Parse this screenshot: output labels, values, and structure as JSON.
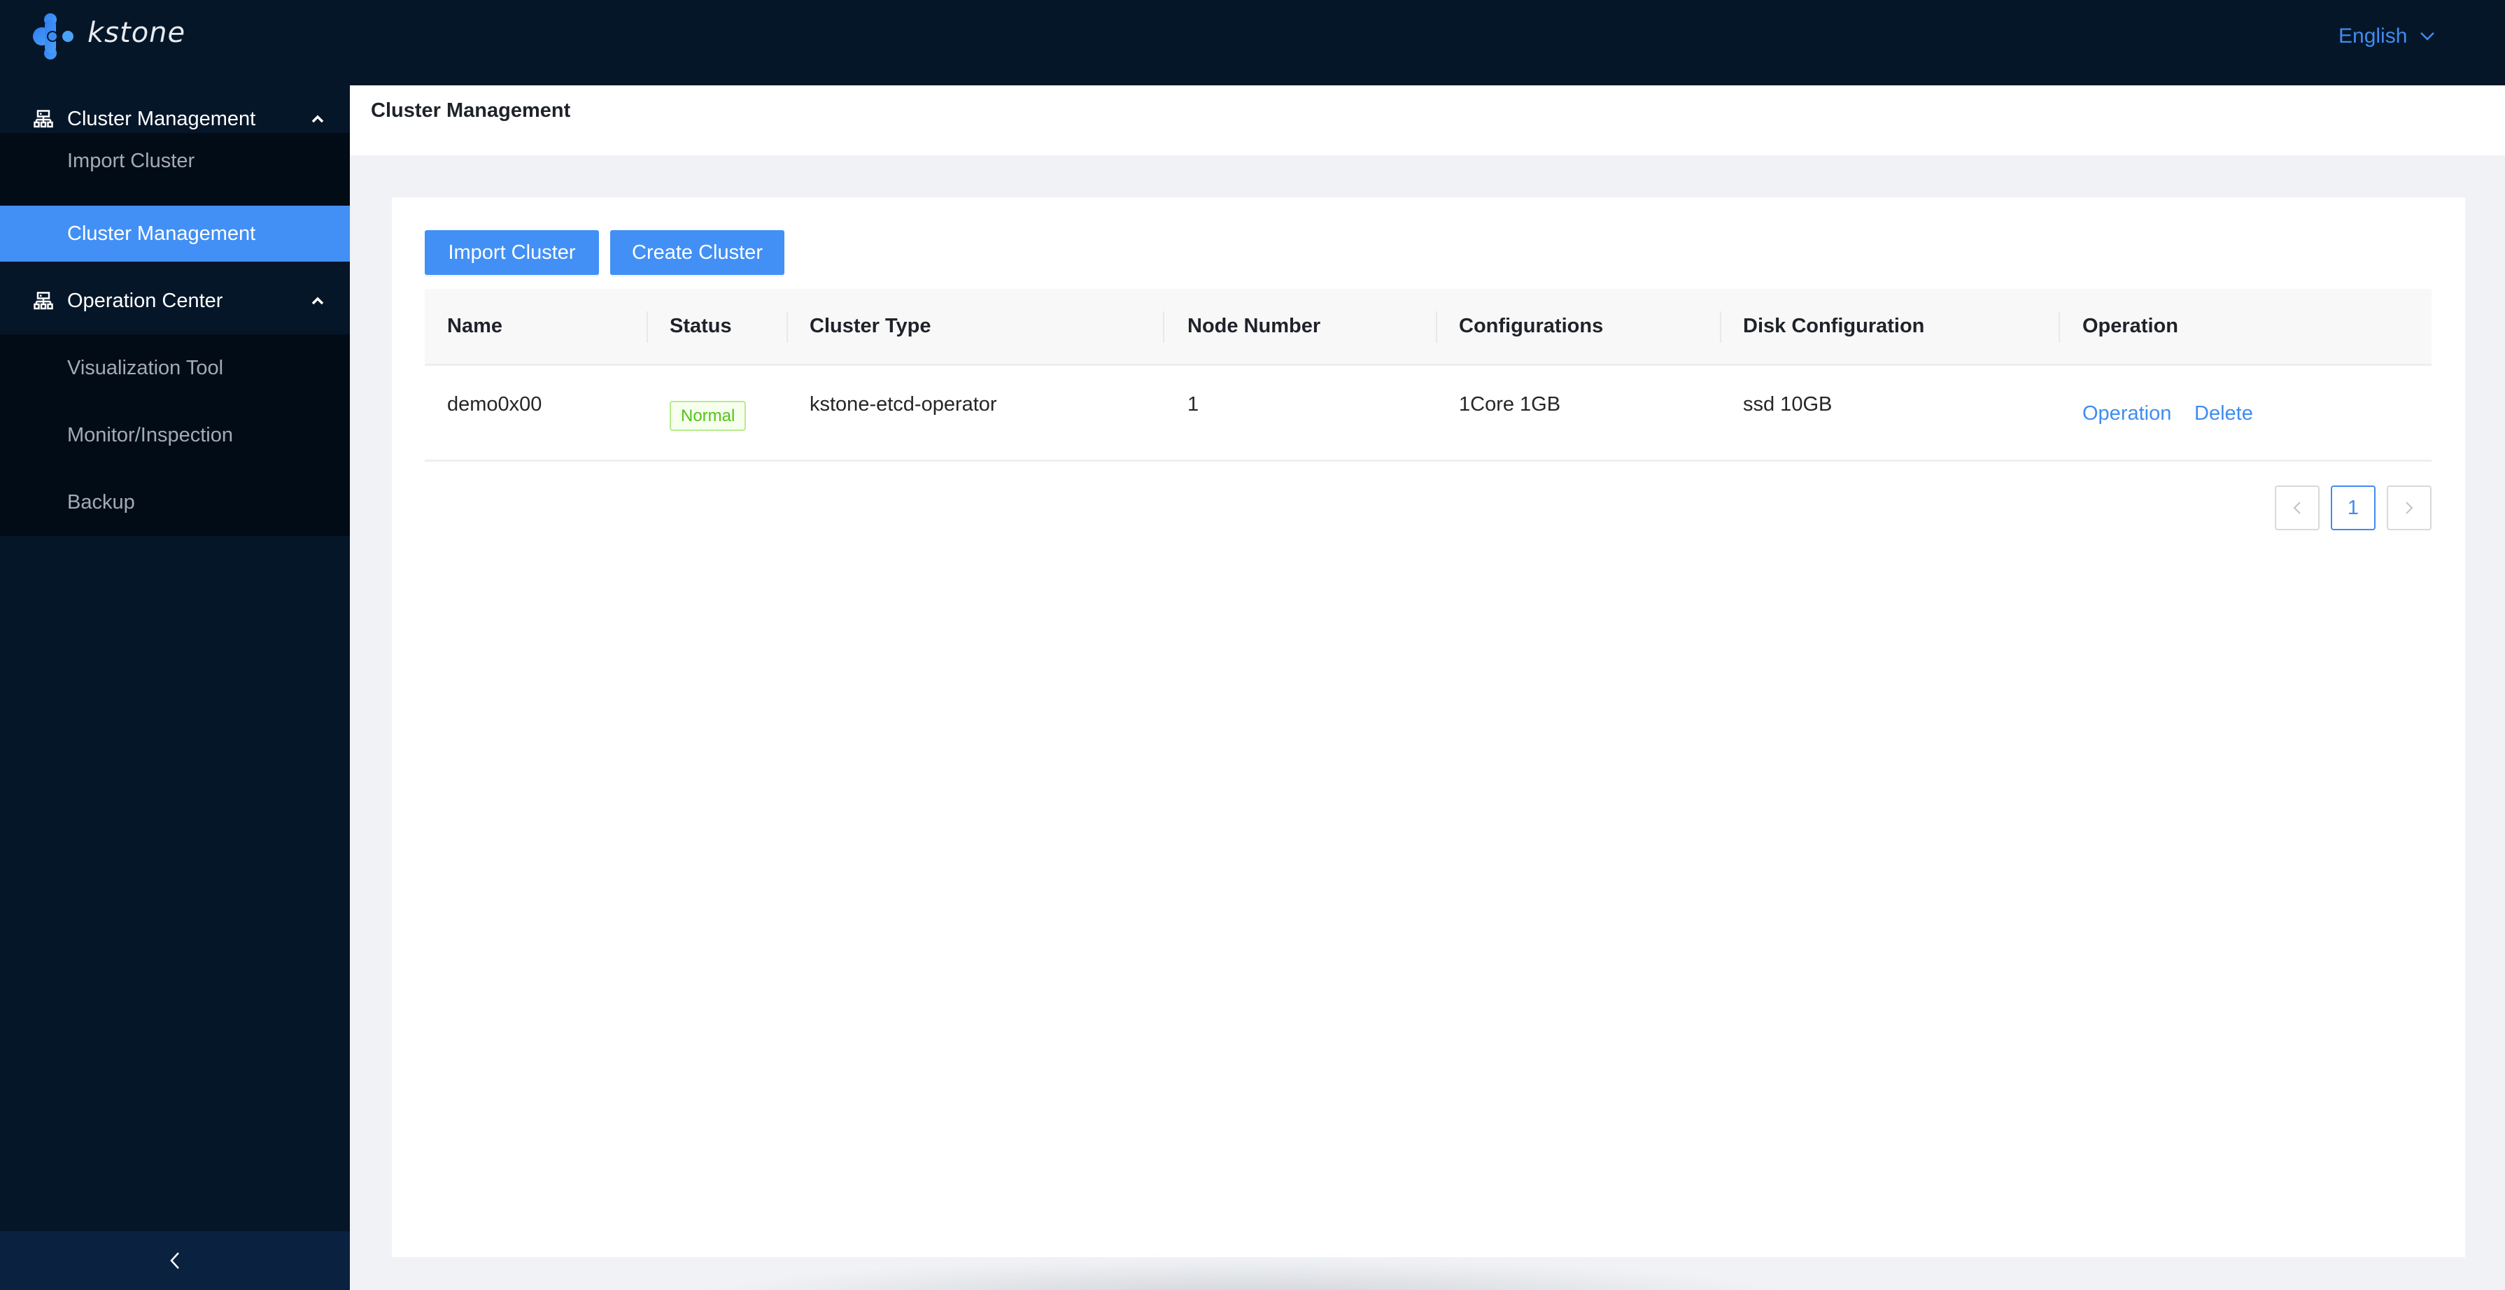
{
  "app": {
    "brand": "kstone",
    "logo_icon": "kstone-logo-icon",
    "language": "English"
  },
  "sidebar": {
    "groups": [
      {
        "label": "Cluster Management",
        "icon": "cluster-icon",
        "expanded": true,
        "items": [
          {
            "label": "Import Cluster",
            "active": false
          },
          {
            "label": "Cluster Management",
            "active": true
          }
        ]
      },
      {
        "label": "Operation Center",
        "icon": "cluster-icon",
        "expanded": true,
        "items": [
          {
            "label": "Visualization Tool",
            "active": false
          },
          {
            "label": "Monitor/Inspection",
            "active": false
          },
          {
            "label": "Backup",
            "active": false
          }
        ]
      }
    ],
    "collapse_icon": "chevron-left-icon"
  },
  "page": {
    "title": "Cluster Management"
  },
  "toolbar": {
    "import_label": "Import Cluster",
    "create_label": "Create Cluster"
  },
  "table": {
    "columns": [
      "Name",
      "Status",
      "Cluster Type",
      "Node Number",
      "Configurations",
      "Disk Configuration",
      "Operation"
    ],
    "rows": [
      {
        "name": "demo0x00",
        "status": "Normal",
        "cluster_type": "kstone-etcd-operator",
        "node_number": "1",
        "configurations": "1Core 1GB",
        "disk_configuration": "ssd 10GB",
        "actions": [
          "Operation",
          "Delete"
        ]
      }
    ]
  },
  "pagination": {
    "current_page": "1"
  },
  "colors": {
    "accent": "#4290f5",
    "link": "#3f8cf0",
    "sidebar_bg": "#061629",
    "submenu_bg": "#020c17",
    "status_normal": "#52c41a"
  }
}
